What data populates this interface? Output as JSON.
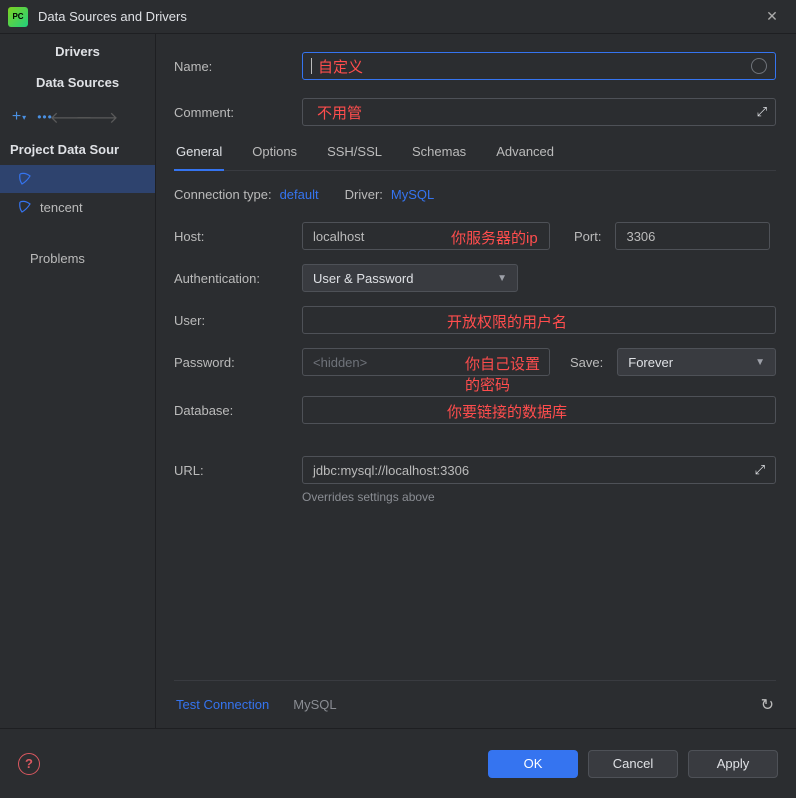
{
  "titlebar": {
    "title": "Data Sources and Drivers"
  },
  "sidebar": {
    "drivers_label": "Drivers",
    "datasources_label": "Data Sources",
    "section_label": "Project Data Sour",
    "items": [
      {
        "label": ""
      },
      {
        "label": "tencent"
      }
    ],
    "problems_label": "Problems"
  },
  "form": {
    "name_label": "Name:",
    "name_value": "",
    "comment_label": "Comment:",
    "comment_value": ""
  },
  "tabs": [
    "General",
    "Options",
    "SSH/SSL",
    "Schemas",
    "Advanced"
  ],
  "conn": {
    "type_label": "Connection type:",
    "type_value": "default",
    "driver_label": "Driver:",
    "driver_value": "MySQL"
  },
  "general": {
    "host_label": "Host:",
    "host_value": "localhost",
    "port_label": "Port:",
    "port_value": "3306",
    "auth_label": "Authentication:",
    "auth_value": "User & Password",
    "user_label": "User:",
    "user_value": "",
    "password_label": "Password:",
    "password_placeholder": "<hidden>",
    "save_label": "Save:",
    "save_value": "Forever",
    "database_label": "Database:",
    "database_value": "",
    "url_label": "URL:",
    "url_value": "jdbc:mysql://localhost:3306",
    "url_note": "Overrides settings above"
  },
  "bottom": {
    "test_label": "Test Connection",
    "mysql_label": "MySQL"
  },
  "footer": {
    "ok": "OK",
    "cancel": "Cancel",
    "apply": "Apply"
  },
  "annotations": {
    "name": "自定义",
    "comment": "不用管",
    "host": "你服务器的ip",
    "user": "开放权限的用户名",
    "password": "你自己设置的密码",
    "database": "你要链接的数据库"
  }
}
